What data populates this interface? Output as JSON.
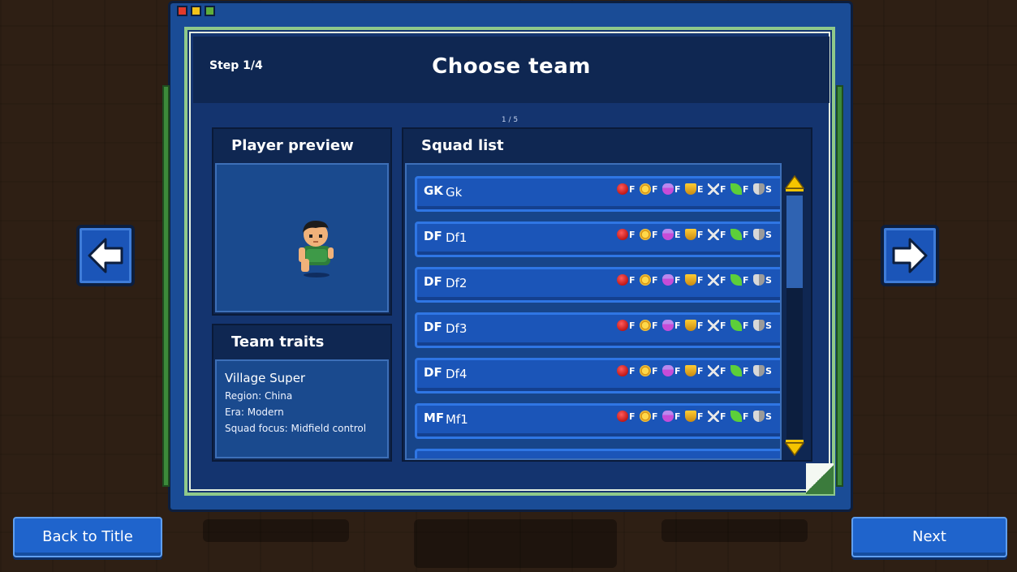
{
  "window": {
    "title": "Choose team",
    "step": "Step 1/4",
    "page_indicator": "1 / 5"
  },
  "player_preview": {
    "heading": "Player preview"
  },
  "team_traits": {
    "heading": "Team traits",
    "name": "Village Super",
    "region": "Region: China",
    "era": "Era: Modern",
    "squad_focus": "Squad focus: Midfield control"
  },
  "squad_list": {
    "heading": "Squad list",
    "stat_icons": [
      "apple-icon",
      "medal-icon",
      "potion-icon",
      "trophy-icon",
      "runner-icon",
      "leaf-icon",
      "shield-icon"
    ],
    "rows": [
      {
        "pos": "GK",
        "name": "Gk",
        "grades": [
          "F",
          "F",
          "F",
          "E",
          "F",
          "F",
          "S"
        ]
      },
      {
        "pos": "DF",
        "name": "Df1",
        "grades": [
          "F",
          "F",
          "E",
          "F",
          "F",
          "F",
          "S"
        ]
      },
      {
        "pos": "DF",
        "name": "Df2",
        "grades": [
          "F",
          "F",
          "F",
          "F",
          "F",
          "F",
          "S"
        ]
      },
      {
        "pos": "DF",
        "name": "Df3",
        "grades": [
          "F",
          "F",
          "F",
          "F",
          "F",
          "F",
          "S"
        ]
      },
      {
        "pos": "DF",
        "name": "Df4",
        "grades": [
          "F",
          "F",
          "F",
          "F",
          "F",
          "F",
          "S"
        ]
      },
      {
        "pos": "MF",
        "name": "Mf1",
        "grades": [
          "F",
          "F",
          "F",
          "F",
          "F",
          "F",
          "S"
        ]
      }
    ]
  },
  "buttons": {
    "back": "Back to Title",
    "next": "Next"
  },
  "colors": {
    "panel_dark": "#0f2752",
    "row_blue": "#1b55b8",
    "accent_green": "#8fc98a",
    "scroll_arrow": "#f5c400"
  }
}
